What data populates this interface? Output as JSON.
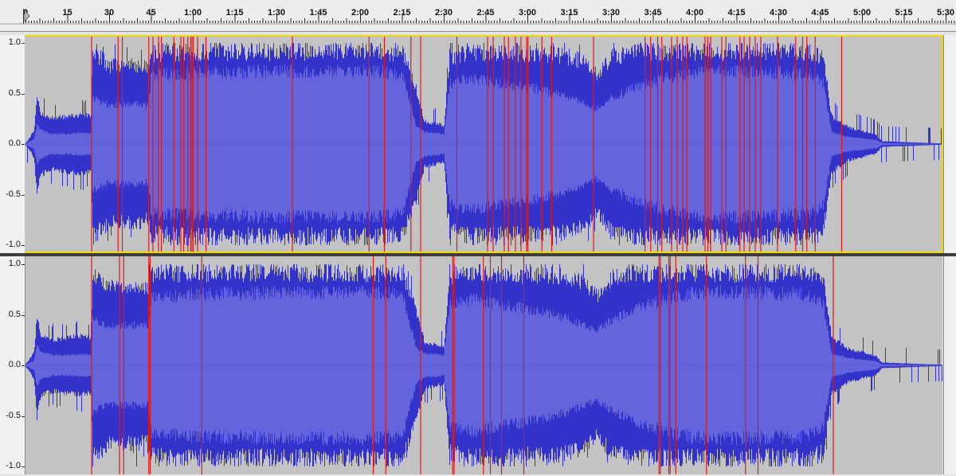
{
  "timeline": {
    "labels": [
      "0",
      "15",
      "30",
      "45",
      "1:00",
      "1:15",
      "1:30",
      "1:45",
      "2:00",
      "2:15",
      "2:30",
      "2:45",
      "3:00",
      "3:15",
      "3:30",
      "3:45",
      "4:00",
      "4:15",
      "4:30",
      "4:45",
      "5:00",
      "5:15",
      "5:30"
    ],
    "duration_seconds": 335,
    "seconds_per_label": 15
  },
  "tracks": [
    {
      "id": "left",
      "scale_labels": [
        "1.0",
        "0.5",
        "0.0",
        "-0.5",
        "-1.0"
      ],
      "selected": true,
      "markers_seconds": [
        24,
        33.5,
        35,
        44.5,
        46,
        48,
        49,
        53.5,
        56,
        57,
        58.5,
        59.5,
        60,
        60.5,
        62,
        65,
        96,
        123.5,
        129,
        138.5,
        142,
        155,
        166,
        168,
        172,
        173.5,
        176,
        178,
        180,
        180.5,
        185.5,
        189,
        204,
        222.5,
        224.5,
        227,
        228.5,
        232,
        234,
        236,
        237.5,
        244,
        245,
        246,
        250,
        251.5,
        256.5,
        258,
        260,
        262,
        264,
        270,
        276.5,
        279,
        280.5,
        283.5,
        293
      ]
    },
    {
      "id": "right",
      "scale_labels": [
        "1.0",
        "0.5",
        "0.0",
        "-0.5",
        "-1.0"
      ],
      "selected": false,
      "markers_seconds": [
        24,
        34,
        35.5,
        44.5,
        45,
        63.5,
        125,
        129.5,
        142,
        153.5,
        154,
        164.5,
        167,
        171,
        179,
        227.5,
        228,
        231,
        231.5,
        233.5,
        244.5,
        258.5,
        263,
        290
      ]
    }
  ],
  "colors": {
    "wave_peak": "#3333cc",
    "wave_rms": "#6464dc",
    "wave_background": "#c3c3c3",
    "marker": "#e01818",
    "selection_border": "#f0d800"
  },
  "waveform": {
    "envelope": [
      [
        0,
        0.02,
        0.01
      ],
      [
        1,
        0.05,
        0.02
      ],
      [
        3,
        0.15,
        0.05
      ],
      [
        4,
        0.55,
        0.2
      ],
      [
        5,
        0.35,
        0.15
      ],
      [
        7,
        0.3,
        0.12
      ],
      [
        10,
        0.28,
        0.1
      ],
      [
        15,
        0.3,
        0.1
      ],
      [
        20,
        0.32,
        0.11
      ],
      [
        23.5,
        0.3,
        0.1
      ],
      [
        24,
        1.0,
        0.45
      ],
      [
        30,
        0.85,
        0.38
      ],
      [
        40,
        0.85,
        0.4
      ],
      [
        44,
        0.82,
        0.38
      ],
      [
        45,
        0.98,
        0.68
      ],
      [
        60,
        1.0,
        0.7
      ],
      [
        90,
        1.0,
        0.72
      ],
      [
        120,
        1.0,
        0.72
      ],
      [
        135,
        1.0,
        0.7
      ],
      [
        140,
        0.6,
        0.18
      ],
      [
        143,
        0.25,
        0.12
      ],
      [
        150,
        0.2,
        0.1
      ],
      [
        152,
        0.95,
        0.6
      ],
      [
        160,
        1.0,
        0.65
      ],
      [
        175,
        0.98,
        0.58
      ],
      [
        190,
        0.98,
        0.5
      ],
      [
        200,
        0.9,
        0.4
      ],
      [
        205,
        0.75,
        0.35
      ],
      [
        210,
        0.95,
        0.45
      ],
      [
        220,
        1.0,
        0.58
      ],
      [
        240,
        1.0,
        0.72
      ],
      [
        260,
        1.0,
        0.72
      ],
      [
        280,
        1.0,
        0.7
      ],
      [
        286,
        0.95,
        0.6
      ],
      [
        289,
        0.3,
        0.12
      ],
      [
        295,
        0.18,
        0.07
      ],
      [
        305,
        0.1,
        0.04
      ],
      [
        307,
        0.03,
        0.01
      ],
      [
        335,
        0,
        0
      ]
    ]
  }
}
